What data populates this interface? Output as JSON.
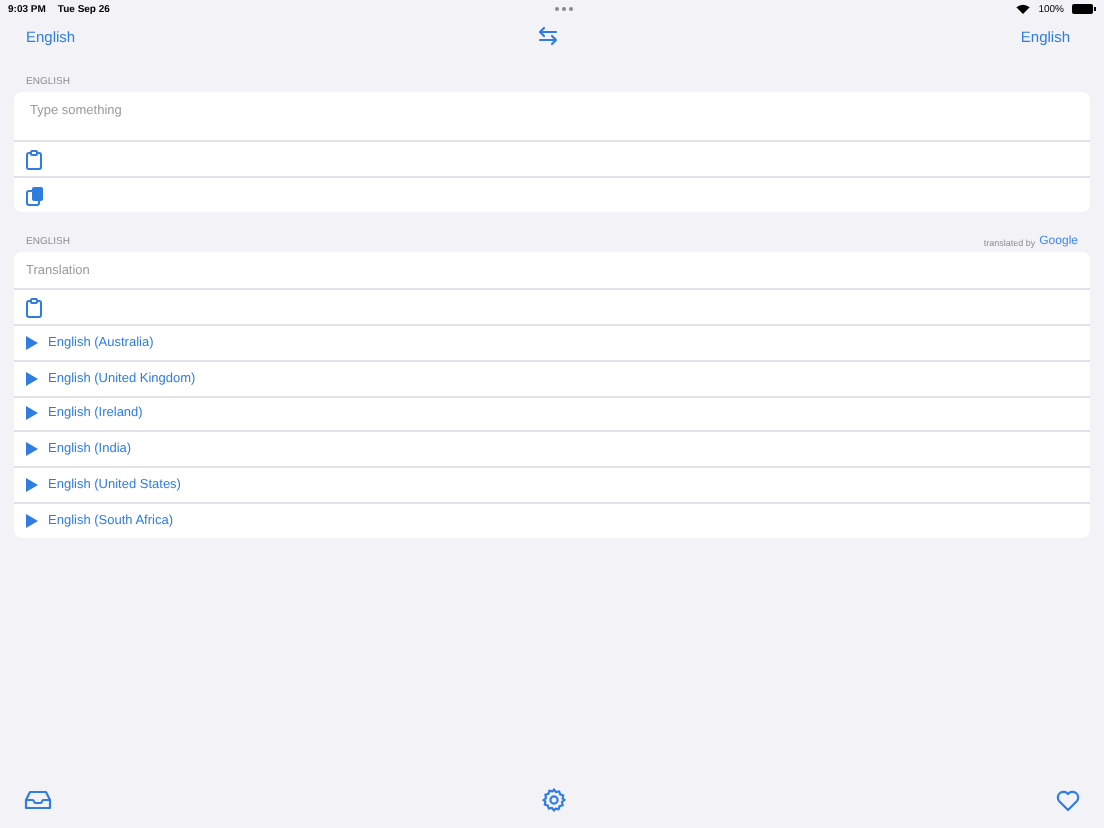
{
  "status_bar": {
    "time": "9:03 PM",
    "date": "Tue Sep 26",
    "battery": "100%"
  },
  "nav": {
    "source_language": "English",
    "target_language": "English"
  },
  "input_section": {
    "label": "ENGLISH",
    "placeholder": "Type something"
  },
  "output_section": {
    "label": "ENGLISH",
    "credit": "translated by",
    "credit_brand": "Google",
    "placeholder": "Translation",
    "voices": [
      "English (Australia)",
      "English (United Kingdom)",
      "English (Ireland)",
      "English (India)",
      "English (United States)",
      "English (South Africa)"
    ]
  }
}
